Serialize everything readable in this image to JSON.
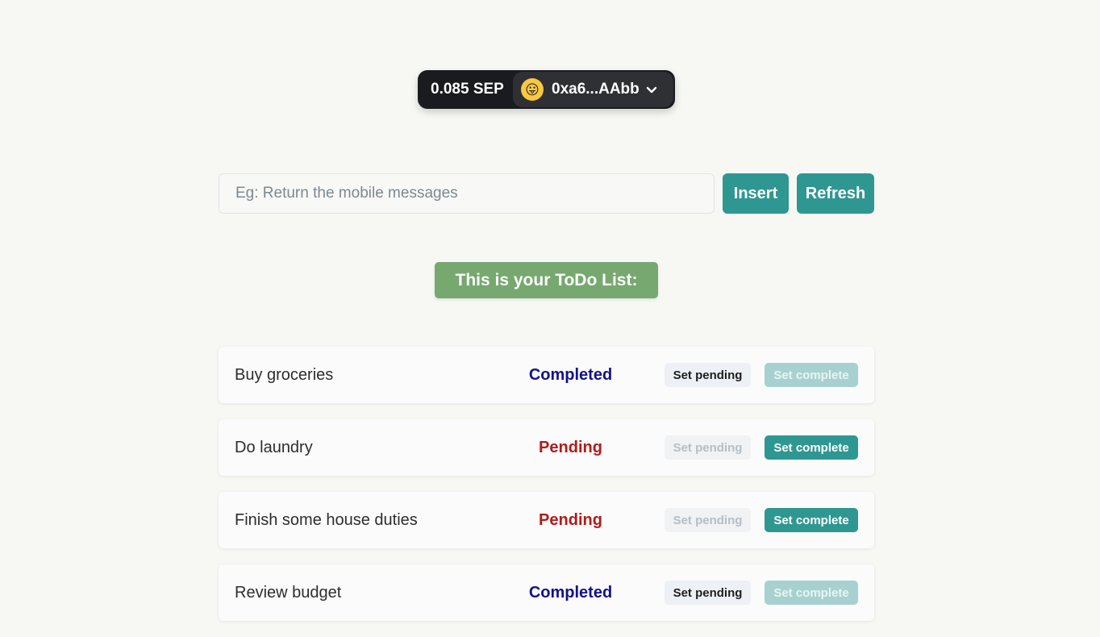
{
  "wallet": {
    "balance": "0.085 SEP",
    "address": "0xa6...AAbb",
    "avatar_icon": "emoji-face-icon",
    "menu_icon": "chevron-down-icon"
  },
  "form": {
    "placeholder": "Eg: Return the mobile messages",
    "value": "",
    "insert_label": "Insert",
    "refresh_label": "Refresh"
  },
  "heading": "This is your ToDo List:",
  "todos": [
    {
      "task": "Buy groceries",
      "status": "Completed",
      "set_pending_label": "Set pending",
      "set_complete_label": "Set complete",
      "pending_enabled": true,
      "complete_enabled": false
    },
    {
      "task": "Do laundry",
      "status": "Pending",
      "set_pending_label": "Set pending",
      "set_complete_label": "Set complete",
      "pending_enabled": false,
      "complete_enabled": true
    },
    {
      "task": "Finish some house duties",
      "status": "Pending",
      "set_pending_label": "Set pending",
      "set_complete_label": "Set complete",
      "pending_enabled": false,
      "complete_enabled": true
    },
    {
      "task": "Review budget",
      "status": "Completed",
      "set_pending_label": "Set pending",
      "set_complete_label": "Set complete",
      "pending_enabled": true,
      "complete_enabled": false
    }
  ],
  "colors": {
    "accent": "#2f9792",
    "heading_bg": "#76a86f",
    "completed": "#13128a",
    "pending": "#b01b1b"
  }
}
